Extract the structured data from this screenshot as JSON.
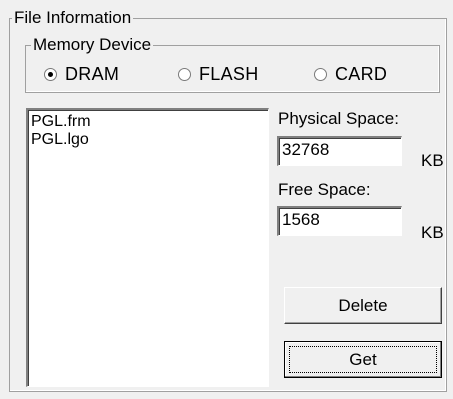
{
  "file_information": {
    "title": "File Information",
    "memory_device": {
      "title": "Memory Device",
      "options": [
        {
          "label": "DRAM",
          "checked": true
        },
        {
          "label": "FLASH",
          "checked": false
        },
        {
          "label": "CARD",
          "checked": false
        }
      ]
    },
    "files": [
      "PGL.frm",
      "PGL.lgo"
    ],
    "physical_space": {
      "label": "Physical Space:",
      "value": "32768",
      "unit": "KB"
    },
    "free_space": {
      "label": "Free Space:",
      "value": "1568",
      "unit": "KB"
    },
    "buttons": {
      "delete": "Delete",
      "get": "Get"
    }
  }
}
